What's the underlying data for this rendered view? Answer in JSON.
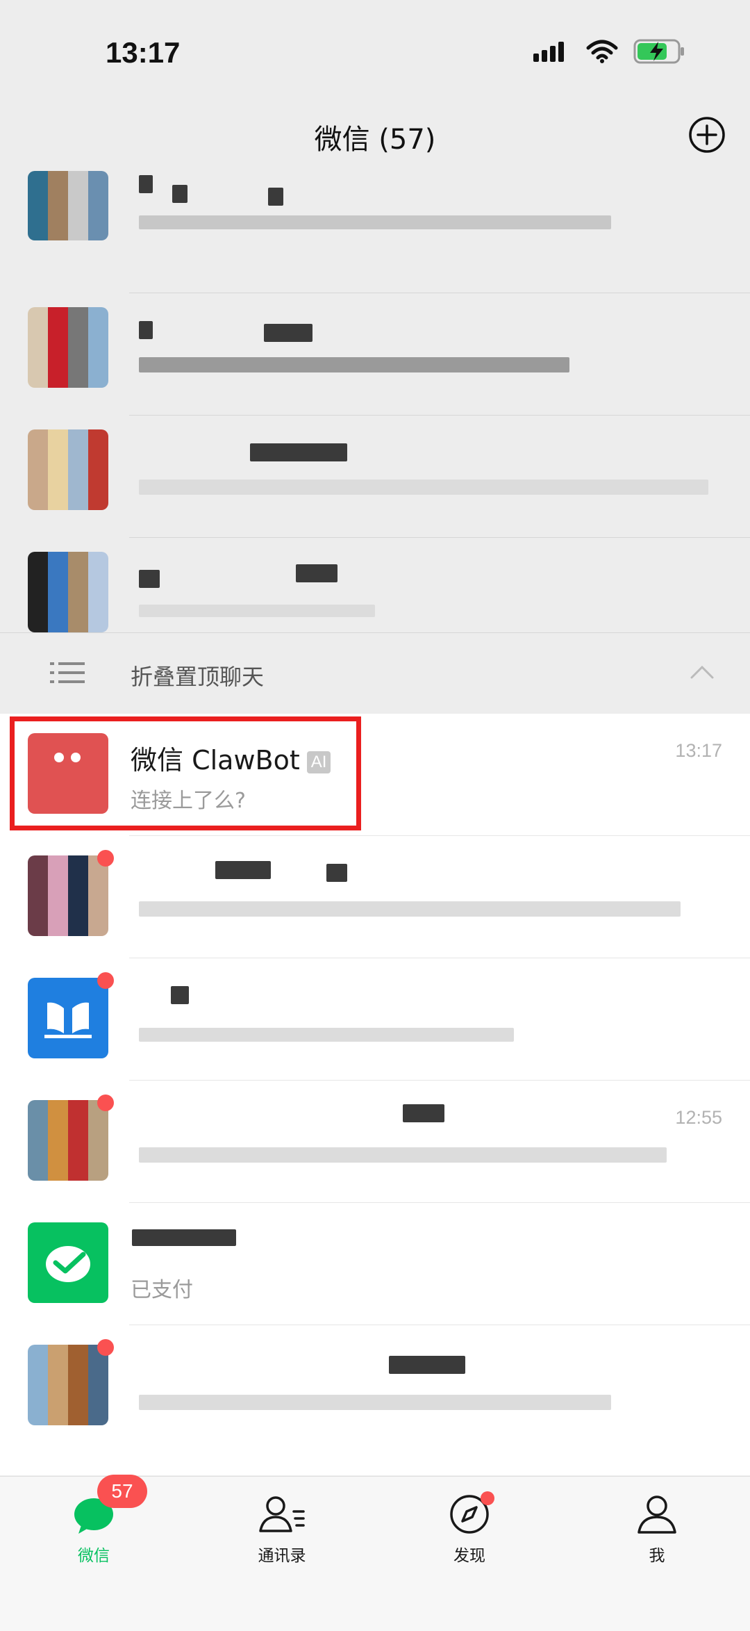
{
  "status_bar": {
    "time": "13:17"
  },
  "nav": {
    "title": "微信 (57)"
  },
  "fold_bar": {
    "label": "折叠置顶聊天"
  },
  "chats": [
    {
      "name": "微信 ClawBot",
      "tag": "AI",
      "preview": "连接上了么?",
      "time": "13:17"
    },
    {
      "name": "",
      "preview": "",
      "time": ""
    },
    {
      "name": "",
      "preview": "",
      "time": ""
    },
    {
      "name": "",
      "preview": "",
      "time": "12:55"
    },
    {
      "name": "",
      "preview": "已支付",
      "time": ""
    },
    {
      "name": "",
      "preview": "",
      "time": ""
    }
  ],
  "tabbar": {
    "badge": "57",
    "tabs": [
      {
        "label": "微信",
        "active": true
      },
      {
        "label": "通讯录"
      },
      {
        "label": "发现"
      },
      {
        "label": "我"
      }
    ]
  },
  "colors": {
    "accent": "#07c160",
    "badge": "#fa5151",
    "highlight": "#ea1f1f"
  }
}
